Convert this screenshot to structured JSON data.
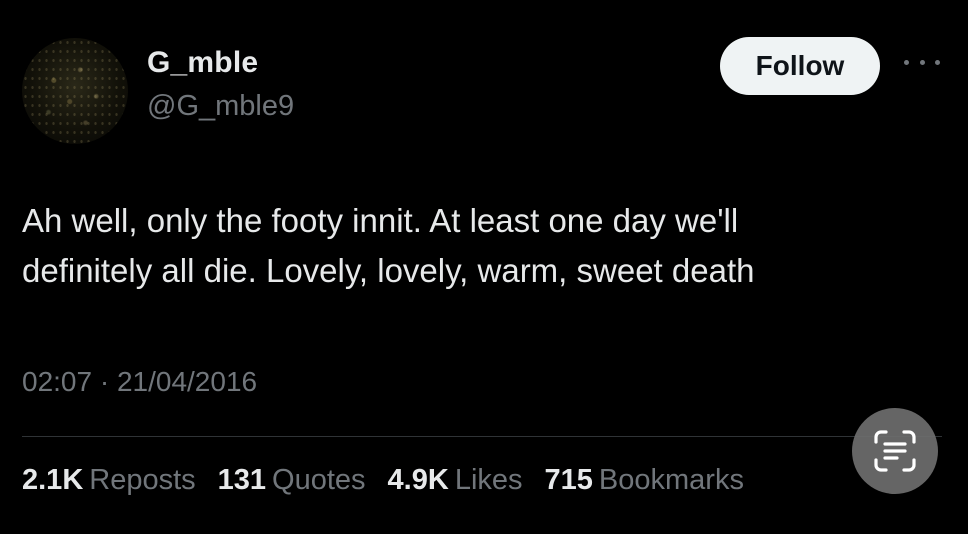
{
  "user": {
    "display_name": "G_mble",
    "handle": "@G_mble9"
  },
  "follow_label": "Follow",
  "tweet": {
    "text_line1": "Ah well, only the footy innit. At least one day we'll",
    "text_line2": "definitely all die. Lovely, lovely, warm, sweet death",
    "timestamp": "02:07 · 21/04/2016"
  },
  "stats": {
    "reposts_count": "2.1K",
    "reposts_label": "Reposts",
    "quotes_count": "131",
    "quotes_label": "Quotes",
    "likes_count": "4.9K",
    "likes_label": "Likes",
    "bookmarks_count": "715",
    "bookmarks_label": "Bookmarks"
  },
  "icons": {
    "more": "more-horizontal-icon",
    "scan": "live-text-scan-icon"
  },
  "colors": {
    "background": "#000000",
    "primary_text": "#e7e9ea",
    "secondary_text": "#71767b",
    "follow_bg": "#eff3f4",
    "divider": "#2f3336"
  }
}
